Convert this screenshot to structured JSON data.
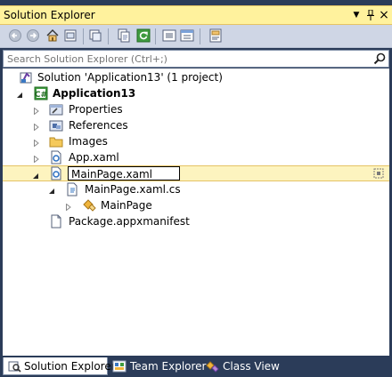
{
  "window": {
    "title": "Solution Explorer",
    "dropdown_glyph": "▼",
    "pin_glyph": "⊥",
    "close_glyph": "×"
  },
  "search": {
    "placeholder": "Search Solution Explorer (Ctrl+;)"
  },
  "tree": {
    "solution_label": "Solution 'Application13' (1 project)",
    "project_label": "Application13",
    "items": [
      {
        "label": "Properties"
      },
      {
        "label": "References"
      },
      {
        "label": "Images"
      },
      {
        "label": "App.xaml"
      },
      {
        "label": "MainPage.xaml"
      },
      {
        "label": "MainPage.xaml.cs"
      },
      {
        "label": "MainPage"
      },
      {
        "label": "Package.appxmanifest"
      }
    ],
    "selected_item": "MainPage.xaml"
  },
  "tabs": [
    {
      "label": "Solution Explorer",
      "active": true
    },
    {
      "label": "Team Explorer",
      "active": false
    },
    {
      "label": "Class View",
      "active": false
    }
  ],
  "colors": {
    "frame": "#2b3c59",
    "title_bar": "#fff29d",
    "selection": "#fdf4bf",
    "toolbar": "#cfd6e5"
  }
}
